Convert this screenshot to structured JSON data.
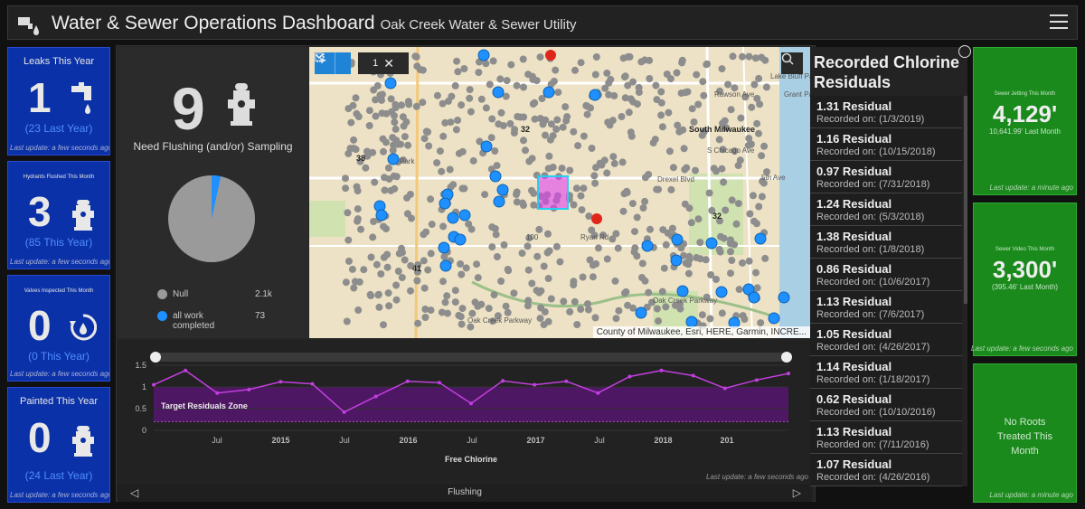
{
  "header": {
    "title": "Water & Sewer Operations Dashboard",
    "subtitle": "Oak Creek Water & Sewer Utility"
  },
  "left_cards": [
    {
      "label": "Leaks This Year",
      "value": "1",
      "sub": "(23 Last Year)",
      "update": "Last update: a few seconds ago",
      "icon": "faucet-icon"
    },
    {
      "label": "Hydrants Flushed This Month",
      "value": "3",
      "sub": "(85 This Year)",
      "update": "Last update: a few seconds ago",
      "icon": "hydrant-icon"
    },
    {
      "label": "Valves Inspected This Month",
      "value": "0",
      "sub": "(0 This Year)",
      "update": "Last update: a few seconds ago",
      "icon": "valve-icon"
    },
    {
      "label": "Painted This Year",
      "value": "0",
      "sub": "(24 Last Year)",
      "update": "Last update: a few seconds ago",
      "icon": "hydrant-icon"
    }
  ],
  "flushing": {
    "count": "9",
    "caption": "Need Flushing (and/or) Sampling",
    "legend": [
      {
        "label": "Null",
        "value": "2.1k",
        "color": "#9a9a9a"
      },
      {
        "label": "all work completed",
        "value": "73",
        "color": "#1e90ff"
      }
    ],
    "pie": {
      "null_share": 0.966,
      "completed_share": 0.034
    }
  },
  "map": {
    "tool_count": "1",
    "labels": [
      "Rawson Ave",
      "South Milwaukee",
      "Drexel Blvd",
      "Grant Park",
      "Lake Bluff Park",
      "Oak Creek Parkway",
      "Oak Creek Parkway",
      "Park",
      "5th Ave",
      "S Chicago Ave",
      "41",
      "32",
      "38",
      "32",
      "100",
      "Ryan Rd"
    ],
    "attribution": "County of Milwaukee, Esri, HERE, Garmin, INCRE..."
  },
  "chart_data": {
    "type": "line",
    "x": [
      "2014-02",
      "2014-05",
      "2014-07",
      "2014-10",
      "2015-01",
      "2015-04",
      "2015-07",
      "2015-10",
      "2016-01",
      "2016-04",
      "2016-07",
      "2016-10",
      "2017-01",
      "2017-04",
      "2017-07",
      "2017-10",
      "2018-01",
      "2018-04",
      "2018-07",
      "2018-10",
      "2019-01"
    ],
    "values": [
      1.05,
      1.38,
      0.86,
      0.94,
      1.12,
      1.07,
      0.42,
      0.78,
      1.13,
      1.1,
      0.62,
      1.14,
      1.05,
      1.13,
      0.86,
      1.24,
      1.38,
      1.26,
      0.97,
      1.16,
      1.31
    ],
    "target_zone": [
      0.2,
      1.0
    ],
    "target_label": "Target Residuals Zone",
    "xlabel": "Free Chlorine",
    "ylabel": "",
    "ylim": [
      0,
      1.5
    ],
    "yticks": [
      "0",
      "0.5",
      "1",
      "1.5"
    ],
    "xticks": [
      "Jul",
      "2015",
      "Jul",
      "2016",
      "Jul",
      "2017",
      "Jul",
      "2018",
      "201"
    ],
    "update": "Last update: a few seconds ago",
    "colors": {
      "line": "#c33ee0",
      "zone": "#4e1763"
    }
  },
  "tabs": {
    "current": "Flushing"
  },
  "chlorine": {
    "title": "Recorded Chlorine Residuals",
    "items": [
      {
        "residual": "1.31 Residual",
        "date": "Recorded on: (1/3/2019)"
      },
      {
        "residual": "1.16 Residual",
        "date": "Recorded on: (10/15/2018)"
      },
      {
        "residual": "0.97 Residual",
        "date": "Recorded on: (7/31/2018)"
      },
      {
        "residual": "1.24 Residual",
        "date": "Recorded on: (5/3/2018)"
      },
      {
        "residual": "1.38 Residual",
        "date": "Recorded on: (1/8/2018)"
      },
      {
        "residual": "0.86 Residual",
        "date": "Recorded on: (10/6/2017)"
      },
      {
        "residual": "1.13 Residual",
        "date": "Recorded on: (7/6/2017)"
      },
      {
        "residual": "1.05 Residual",
        "date": "Recorded on: (4/26/2017)"
      },
      {
        "residual": "1.14 Residual",
        "date": "Recorded on: (1/18/2017)"
      },
      {
        "residual": "0.62 Residual",
        "date": "Recorded on: (10/10/2016)"
      },
      {
        "residual": "1.13 Residual",
        "date": "Recorded on: (7/11/2016)"
      },
      {
        "residual": "1.07 Residual",
        "date": "Recorded on: (4/26/2016)"
      }
    ]
  },
  "right_cards": [
    {
      "label": "Sewer Jetting This Month",
      "value": "4,129'",
      "sub": "10,641.99' Last Month",
      "update": "Last update: a minute ago"
    },
    {
      "label": "Sewer Video This Month",
      "value": "3,300'",
      "sub": "(395.46' Last Month)",
      "update": "Last update: a few seconds ago"
    },
    {
      "message": "No Roots Treated This Month",
      "update": "Last update: a minute ago"
    }
  ]
}
